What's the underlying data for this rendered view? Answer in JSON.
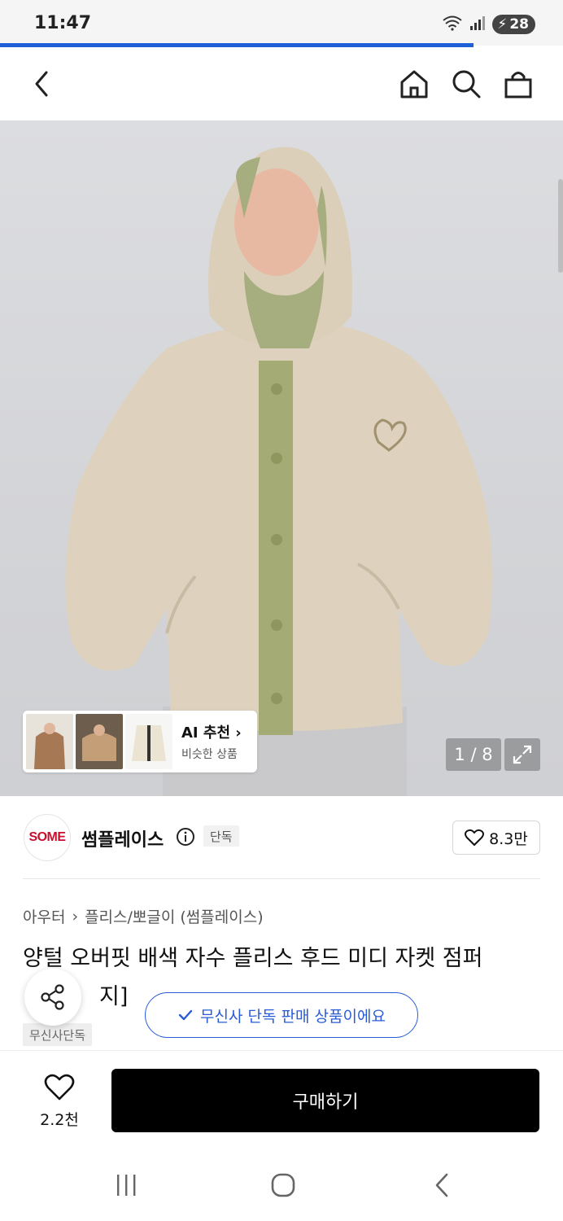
{
  "status_bar": {
    "time": "11:47",
    "battery": "28",
    "network": "5"
  },
  "nav": {
    "back": "back",
    "home": "home",
    "search": "search",
    "cart": "cart"
  },
  "gallery": {
    "counter": "1 / 8",
    "ai_title": "AI 추천",
    "ai_subtitle": "비슷한 상품"
  },
  "brand": {
    "logo_text": "SOME",
    "name": "썸플레이스",
    "tag": "단독",
    "likes": "8.3만"
  },
  "breadcrumb": {
    "first": "아우터",
    "second": "플리스/뽀글이 (썸플레이스)"
  },
  "product": {
    "title_line1": "양털 오버핏 배색 자수 플리스 후드 미디 자켓 점퍼",
    "title_line2_visible": "지]",
    "exclusive_tag": "무신사단독"
  },
  "toast": {
    "text": "무신사 단독 판매 상품이에요"
  },
  "bottom": {
    "wish_count": "2.2천",
    "buy_label": "구매하기"
  },
  "colors": {
    "accent_blue": "#2a5bd7",
    "load_bar": "#1e5fd8",
    "brand_red": "#c8102e"
  }
}
